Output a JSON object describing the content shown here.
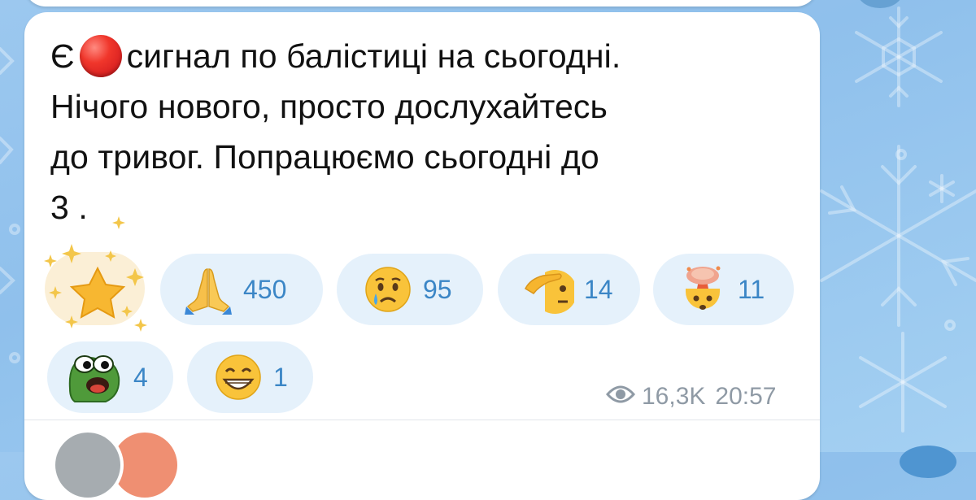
{
  "message": {
    "line1_before": "Є",
    "line1_after": "сигнал по балістиці на сьогодні.",
    "line2": "Нічого нового, просто дослухайтесь",
    "line3": "до тривог. Попрацюємо сьогодні до",
    "line4": "3 .",
    "inline_emoji": "red-circle-icon"
  },
  "reactions": {
    "star": {
      "icon": "star-sparkle-icon",
      "count": ""
    },
    "pray": {
      "icon": "folded-hands-icon",
      "count": "450"
    },
    "cry": {
      "icon": "crying-face-icon",
      "count": "95"
    },
    "salute": {
      "icon": "saluting-face-icon",
      "count": "14"
    },
    "mindblown": {
      "icon": "exploding-head-icon",
      "count": "11"
    },
    "frog": {
      "icon": "pepe-frog-icon",
      "count": "4"
    },
    "grin": {
      "icon": "grinning-face-icon",
      "count": "1"
    }
  },
  "meta": {
    "views": "16,3K",
    "time": "20:57",
    "views_icon": "eye-icon"
  },
  "colors": {
    "background": "#9cc8ef",
    "bubble": "#ffffff",
    "reaction_bg": "#e5f1fb",
    "reaction_text": "#3b86c6",
    "meta_text": "#8f9aa5"
  }
}
